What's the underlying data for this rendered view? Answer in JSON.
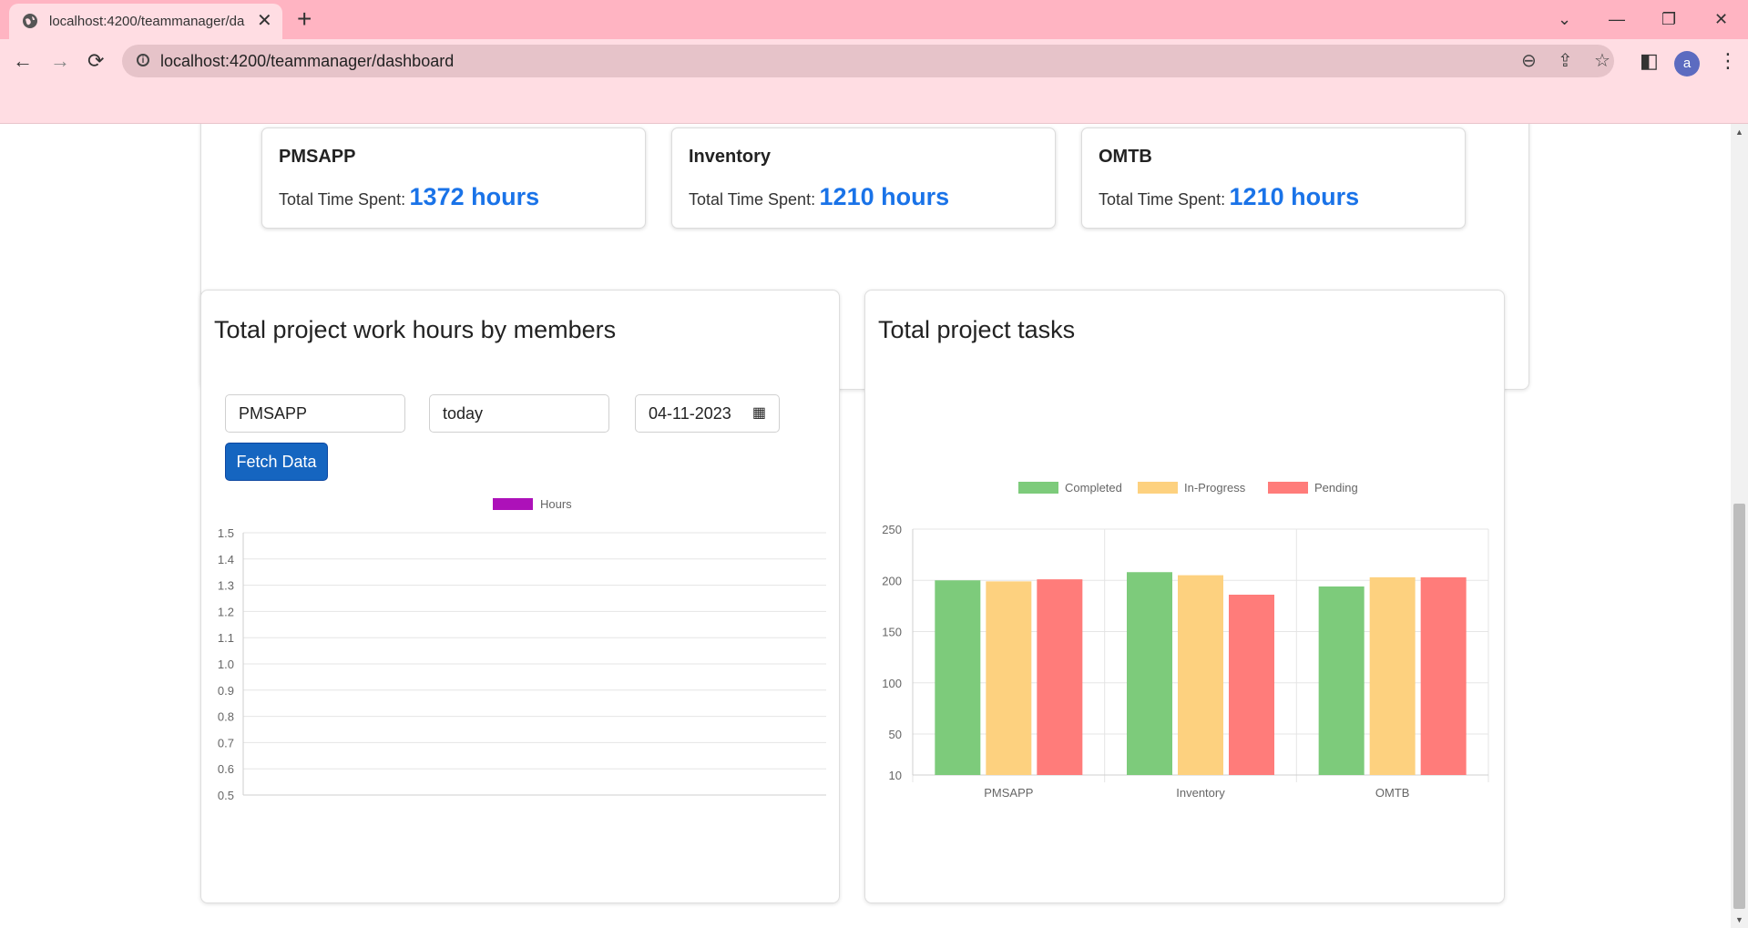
{
  "browser": {
    "tab_title": "localhost:4200/teammanager/da",
    "tab_close": "✕",
    "new_tab": "+",
    "url": "localhost:4200/teammanager/dashboard",
    "back": "←",
    "forward": "→",
    "reload": "⟳",
    "zoom_icon": "⊖",
    "share_icon": "⇪",
    "star_icon": "☆",
    "sidepanel_icon": "◧",
    "avatar_letter": "a",
    "menu_icon": "⋮",
    "win_minimize": "—",
    "win_restore": "❐",
    "win_close": "✕",
    "tab_search": "⌄"
  },
  "projects": [
    {
      "name": "PMSAPP",
      "label": "Total Time Spent:",
      "hours": "1372 hours"
    },
    {
      "name": "Inventory",
      "label": "Total Time Spent:",
      "hours": "1210 hours"
    },
    {
      "name": "OMTB",
      "label": "Total Time Spent:",
      "hours": "1210 hours"
    }
  ],
  "hours_panel": {
    "title": "Total project work hours by members",
    "project_value": "PMSAPP",
    "period_value": "today",
    "date_value": "04-11-2023",
    "fetch_label": "Fetch Data"
  },
  "tasks_panel": {
    "title": "Total project tasks"
  },
  "colors": {
    "accent": "#1a73e8",
    "button": "#1565c0",
    "hours_series": "#ad11b9",
    "completed": "#7dcb7b",
    "in_progress": "#fdd17f",
    "pending": "#ff7c7a"
  },
  "chart_data": [
    {
      "type": "line",
      "legend": [
        "Hours"
      ],
      "series": [
        {
          "name": "Hours",
          "values": []
        }
      ],
      "yticks": [
        "1.5",
        "1.4",
        "1.3",
        "1.2",
        "1.1",
        "1.0",
        "0.9",
        "0.8",
        "0.7",
        "0.6",
        "0.5"
      ],
      "ylim": [
        0.5,
        1.5
      ],
      "grid": true,
      "legend_position": "top-center"
    },
    {
      "type": "bar",
      "categories": [
        "PMSAPP",
        "Inventory",
        "OMTB"
      ],
      "series": [
        {
          "name": "Completed",
          "values": [
            200,
            208,
            194
          ]
        },
        {
          "name": "In-Progress",
          "values": [
            199,
            205,
            203
          ]
        },
        {
          "name": "Pending",
          "values": [
            201,
            186,
            203
          ]
        }
      ],
      "yticks": [
        250,
        200,
        150,
        100,
        50,
        10
      ],
      "ylim": [
        10,
        250
      ],
      "grid": true,
      "legend_position": "top-center"
    }
  ]
}
